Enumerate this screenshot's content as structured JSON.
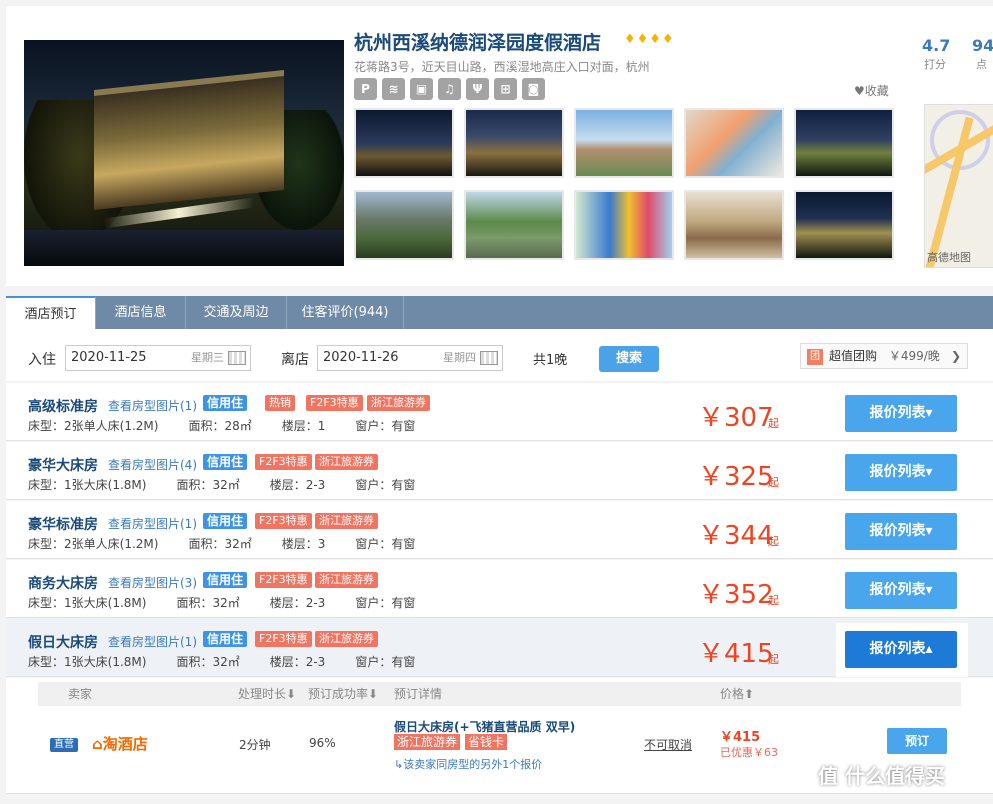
{
  "hotel": {
    "name": "杭州西溪纳德润泽园度假酒店",
    "stars": "♦♦♦♦",
    "address": "花蒋路3号，近天目山路，西溪湿地高庄入口对面，杭州",
    "facilities": [
      "P",
      "wifi",
      "停",
      "铃",
      "餐",
      "健",
      "投"
    ],
    "favorite": "♥收藏",
    "rating": "4.7",
    "rating_label": "打分",
    "reviews_count": "94",
    "reviews_label": "点",
    "map_label": "高德地图"
  },
  "tabs": [
    "酒店预订",
    "酒店信息",
    "交通及周边",
    "住客评价(944)"
  ],
  "search": {
    "checkin_label": "入住",
    "checkin_date": "2020-11-25",
    "checkin_weekday": "星期三",
    "checkout_label": "离店",
    "checkout_date": "2020-11-26",
    "checkout_weekday": "星期四",
    "nights": "共1晚",
    "search_button": "搜索",
    "group_icon": "团",
    "group_label": "超值团购",
    "group_price": "￥499/晚",
    "group_arrow": "❯"
  },
  "rooms": [
    {
      "name": "高级标准房",
      "pics": "查看房型图片(1)",
      "credit": "信用住",
      "tags": [
        "热销",
        "F2F3特惠",
        "浙江旅游券"
      ],
      "bed": "床型：2张单人床(1.2M)",
      "area": "面积：28㎡",
      "floor": "楼层：1",
      "window": "窗户：有窗",
      "price": "￥307",
      "qi": "起",
      "button": "报价列表▾"
    },
    {
      "name": "豪华大床房",
      "pics": "查看房型图片(4)",
      "credit": "信用住",
      "tags": [
        "F2F3特惠",
        "浙江旅游券"
      ],
      "bed": "床型：1张大床(1.8M)",
      "area": "面积：32㎡",
      "floor": "楼层：2-3",
      "window": "窗户：有窗",
      "price": "￥325",
      "qi": "起",
      "button": "报价列表▾"
    },
    {
      "name": "豪华标准房",
      "pics": "查看房型图片(1)",
      "credit": "信用住",
      "tags": [
        "F2F3特惠",
        "浙江旅游券"
      ],
      "bed": "床型：2张单人床(1.2M)",
      "area": "面积：32㎡",
      "floor": "楼层：3",
      "window": "窗户：有窗",
      "price": "￥344",
      "qi": "起",
      "button": "报价列表▾"
    },
    {
      "name": "商务大床房",
      "pics": "查看房型图片(3)",
      "credit": "信用住",
      "tags": [
        "F2F3特惠",
        "浙江旅游券"
      ],
      "bed": "床型：1张大床(1.8M)",
      "area": "面积：32㎡",
      "floor": "楼层：2-3",
      "window": "窗户：有窗",
      "price": "￥352",
      "qi": "起",
      "button": "报价列表▾"
    },
    {
      "name": "假日大床房",
      "pics": "查看房型图片(1)",
      "credit": "信用住",
      "tags": [
        "F2F3特惠",
        "浙江旅游券"
      ],
      "bed": "床型：1张大床(1.8M)",
      "area": "面积：32㎡",
      "floor": "楼层：2-3",
      "window": "窗户：有窗",
      "price": "￥415",
      "qi": "起",
      "button": "报价列表▴"
    }
  ],
  "offer": {
    "headers": {
      "seller": "卖家",
      "duration": "处理时长⬇",
      "success": "预订成功率⬇",
      "detail": "预订详情",
      "price": "价格⬆"
    },
    "seller_badge": "直营",
    "seller_name": "淘酒店",
    "duration": "2分钟",
    "success": "96%",
    "detail_title": "假日大床房(+飞猪直营品质 双早)",
    "detail_tags": [
      "浙江旅游券",
      "省钱卡"
    ],
    "more": "↳该卖家同房型的另外1个报价",
    "cancel": "不可取消",
    "price": "￥415",
    "saved": "已优惠￥63",
    "book": "预订"
  },
  "watermark": "值 什么值得买"
}
